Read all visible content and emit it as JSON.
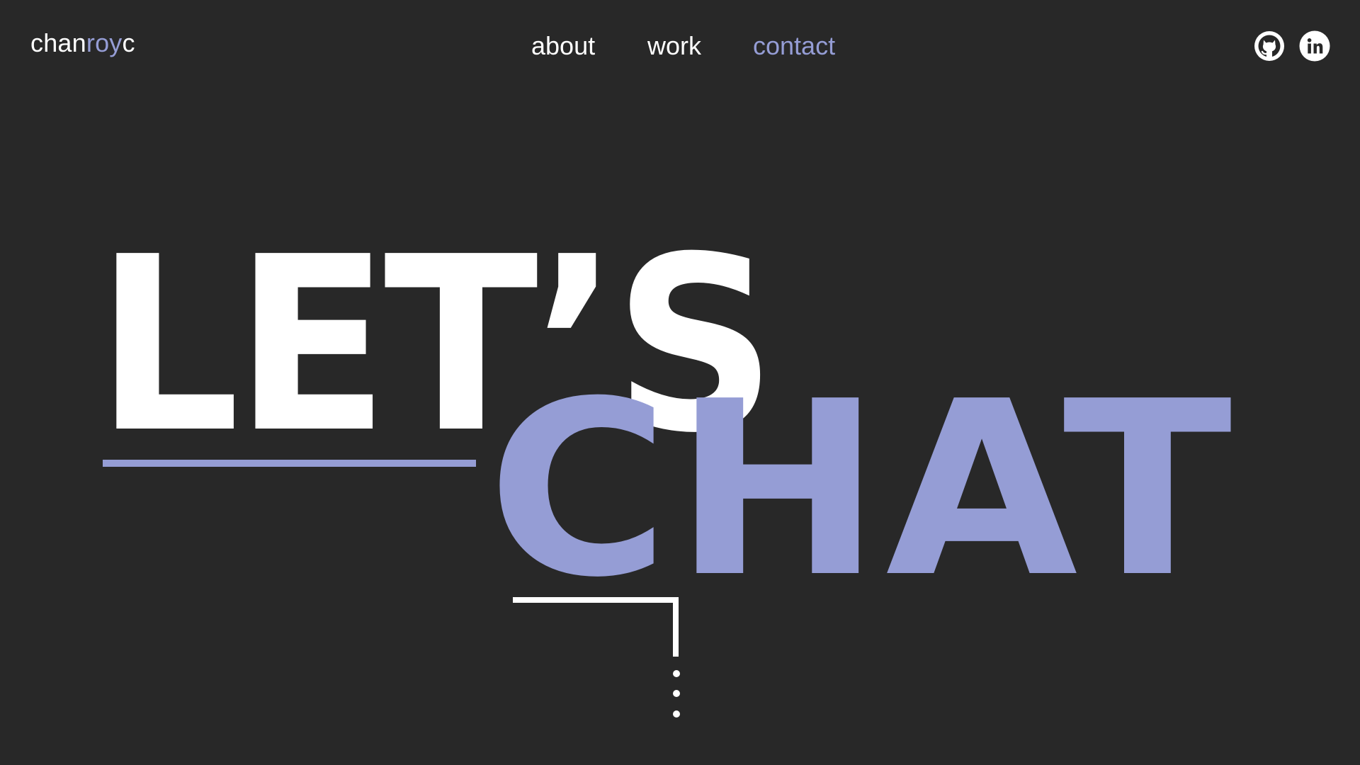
{
  "header": {
    "logo": {
      "prefix": "chan",
      "accent": "roy",
      "suffix": "c"
    },
    "nav": [
      {
        "label": "about",
        "active": false
      },
      {
        "label": "work",
        "active": false
      },
      {
        "label": "contact",
        "active": true
      }
    ],
    "social": [
      {
        "icon": "github-icon"
      },
      {
        "icon": "linkedin-icon"
      }
    ]
  },
  "hero": {
    "line1": "LET’S",
    "line2": "CHAT"
  },
  "colors": {
    "background": "#282828",
    "text": "#ffffff",
    "accent": "#959dd5"
  }
}
